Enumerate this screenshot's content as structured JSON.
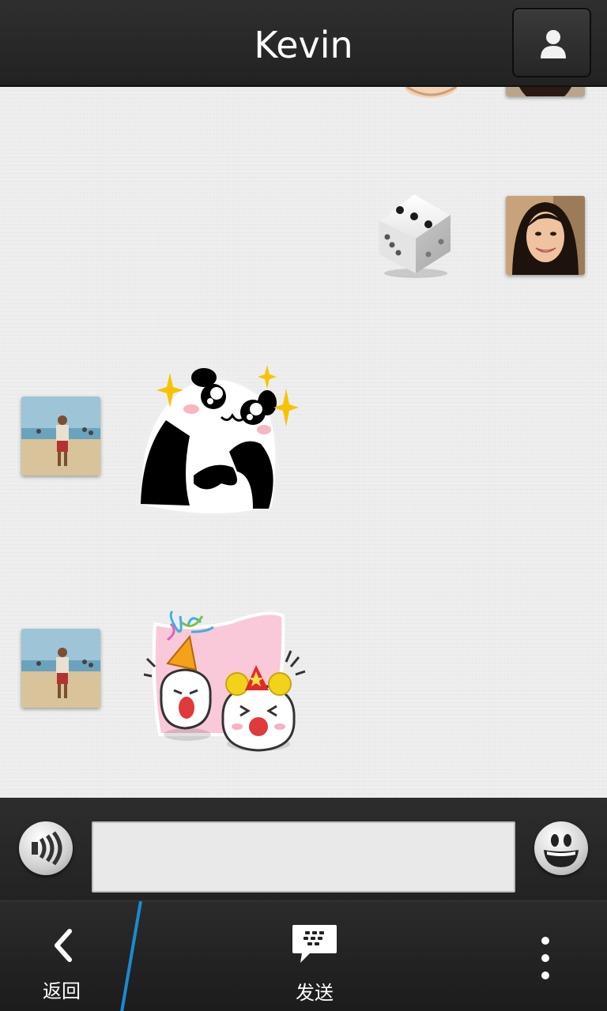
{
  "header": {
    "title": "Kevin",
    "contact_icon": "person-icon"
  },
  "chat": {
    "messages": [
      {
        "sender": "me",
        "type": "sticker",
        "sticker": "hand-sticker"
      },
      {
        "sender": "me",
        "type": "sticker",
        "sticker": "dice-sticker",
        "dice_value": 3
      },
      {
        "sender": "Kevin",
        "type": "sticker",
        "sticker": "panda-sticker"
      },
      {
        "sender": "Kevin",
        "type": "sticker",
        "sticker": "party-sticker"
      }
    ]
  },
  "input_bar": {
    "voice_icon": "voice-icon",
    "message_value": "",
    "emoji_icon": "smiley-icon"
  },
  "action_bar": {
    "back_label": "返回",
    "send_label": "发送",
    "send_icon": "bbm-icon",
    "more_icon": "more-vertical-icon"
  },
  "colors": {
    "bar": "#262626",
    "accent": "#1a8ad4",
    "chat_bg": "#ededed"
  }
}
